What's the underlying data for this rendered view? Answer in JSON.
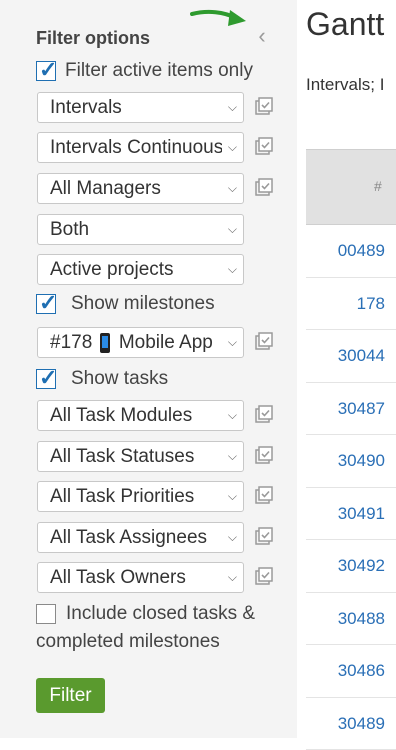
{
  "sidebar": {
    "title": "Filter options",
    "filter_active_label": "Filter active items only",
    "interval_select": "Intervals",
    "interval_type_select": "Intervals Continuous",
    "managers_select": "All Managers",
    "both_select": "Both",
    "projects_select": "Active projects",
    "show_milestones_label": "Show milestones",
    "milestone_select_prefix": "#178",
    "milestone_select_text": "Mobile App",
    "show_tasks_label": "Show tasks",
    "task_modules_select": "All Task Modules",
    "task_statuses_select": "All Task Statuses",
    "task_priorities_select": "All Task Priorities",
    "task_assignees_select": "All Task Assignees",
    "task_owners_select": "All Task Owners",
    "include_closed_label": "Include closed tasks & completed milestones",
    "filter_button": "Filter"
  },
  "main": {
    "title": "Gantt",
    "subtitle": "Intervals; I",
    "table_header_num": "#",
    "rows": [
      "00489",
      "178",
      "30044",
      "30487",
      "30490",
      "30491",
      "30492",
      "30488",
      "30486",
      "30489"
    ]
  },
  "colors": {
    "accent_blue": "#1f6fb2",
    "link_blue": "#2a6fb6",
    "filter_green": "#5a9a2e",
    "annotation_arrow": "#2e9a2e"
  },
  "icons": [
    "collapse-chevron-left-icon",
    "save-preset-icon",
    "mobile-phone-icon",
    "chevron-down-icon"
  ]
}
